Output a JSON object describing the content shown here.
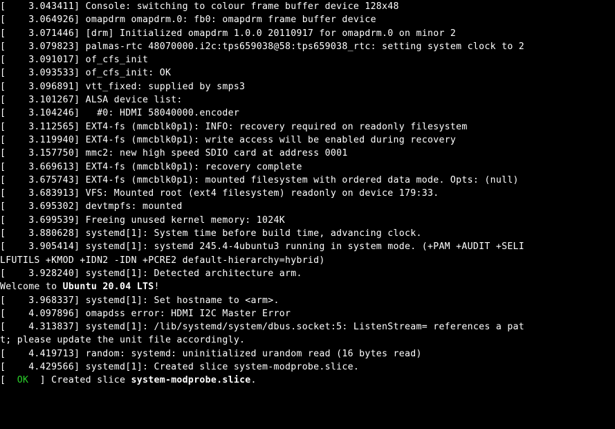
{
  "log": [
    {
      "t": "3.043411",
      "m": "Console: switching to colour frame buffer device 128x48"
    },
    {
      "t": "3.064926",
      "m": "omapdrm omapdrm.0: fb0: omapdrm frame buffer device"
    },
    {
      "t": "3.071446",
      "m": "[drm] Initialized omapdrm 1.0.0 20110917 for omapdrm.0 on minor 2"
    },
    {
      "t": "3.079823",
      "m": "palmas-rtc 48070000.i2c:tps659038@58:tps659038_rtc: setting system clock to 2"
    },
    {
      "t": "3.091017",
      "m": "of_cfs_init"
    },
    {
      "t": "3.093533",
      "m": "of_cfs_init: OK"
    },
    {
      "t": "3.096891",
      "m": "vtt_fixed: supplied by smps3"
    },
    {
      "t": "3.101267",
      "m": "ALSA device list:"
    },
    {
      "t": "3.104246",
      "m": "  #0: HDMI 58040000.encoder"
    },
    {
      "t": "3.112565",
      "m": "EXT4-fs (mmcblk0p1): INFO: recovery required on readonly filesystem"
    },
    {
      "t": "3.119940",
      "m": "EXT4-fs (mmcblk0p1): write access will be enabled during recovery"
    },
    {
      "t": "3.157750",
      "m": "mmc2: new high speed SDIO card at address 0001"
    },
    {
      "t": "3.669613",
      "m": "EXT4-fs (mmcblk0p1): recovery complete"
    },
    {
      "t": "3.675743",
      "m": "EXT4-fs (mmcblk0p1): mounted filesystem with ordered data mode. Opts: (null)"
    },
    {
      "t": "3.683913",
      "m": "VFS: Mounted root (ext4 filesystem) readonly on device 179:33."
    },
    {
      "t": "3.695302",
      "m": "devtmpfs: mounted"
    },
    {
      "t": "3.699539",
      "m": "Freeing unused kernel memory: 1024K"
    },
    {
      "t": "3.880628",
      "m": "systemd[1]: System time before build time, advancing clock."
    },
    {
      "t": "3.905414",
      "m": "systemd[1]: systemd 245.4-4ubuntu3 running in system mode. (+PAM +AUDIT +SELI"
    }
  ],
  "wrap1": "LFUTILS +KMOD +IDN2 -IDN +PCRE2 default-hierarchy=hybrid)",
  "log2": [
    {
      "t": "3.928240",
      "m": "systemd[1]: Detected architecture arm."
    }
  ],
  "welcome_prefix": "Welcome to ",
  "welcome_bold": "Ubuntu 20.04 LTS",
  "welcome_suffix": "!",
  "log3": [
    {
      "t": "3.968337",
      "m": "systemd[1]: Set hostname to <arm>."
    },
    {
      "t": "4.097896",
      "m": "omapdss error: HDMI I2C Master Error"
    },
    {
      "t": "4.313837",
      "m": "systemd[1]: /lib/systemd/system/dbus.socket:5: ListenStream= references a pat"
    }
  ],
  "wrap2": "t; please update the unit file accordingly.",
  "log4": [
    {
      "t": "4.419713",
      "m": "random: systemd: uninitialized urandom read (16 bytes read)"
    },
    {
      "t": "4.429566",
      "m": "systemd[1]: Created slice system-modprobe.slice."
    }
  ],
  "status": {
    "prefix": "[  ",
    "ok": "OK",
    "mid": "  ] Created slice ",
    "bold": "system-modprobe.slice",
    "suffix": "."
  }
}
